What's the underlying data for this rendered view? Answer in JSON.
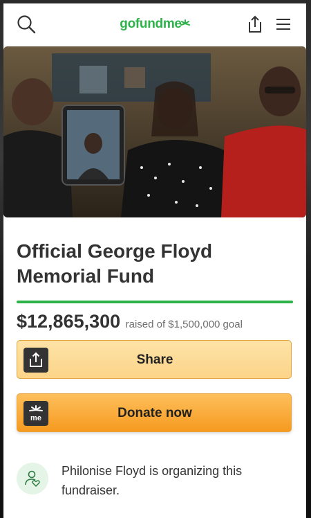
{
  "header": {
    "logo_text": "gofundme",
    "icons": [
      "search-icon",
      "share-upload-icon",
      "menu-icon"
    ],
    "brand_color": "#2db34a"
  },
  "hero": {
    "image_description": "hero-photo"
  },
  "campaign": {
    "title": "Official George Floyd Memorial Fund",
    "amount_raised": "$12,865,300",
    "goal_text": "raised of $1,500,000 goal",
    "progress_fraction": 1.0
  },
  "actions": {
    "share_label": "Share",
    "donate_label": "Donate now",
    "donate_icon_text": "me"
  },
  "organizer": {
    "text": "Philonise Floyd is organizing this fundraiser."
  }
}
